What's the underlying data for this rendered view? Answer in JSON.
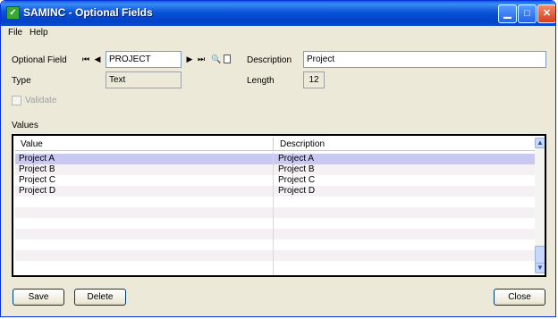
{
  "window": {
    "title": "SAMINC - Optional Fields",
    "controls": {
      "minimize": "▁",
      "maximize": "□",
      "close": "✕"
    }
  },
  "menu": {
    "file": "File",
    "help": "Help"
  },
  "form": {
    "optional_field_label": "Optional Field",
    "optional_field_value": "PROJECT",
    "description_label": "Description",
    "description_value": "Project",
    "type_label": "Type",
    "type_value": "Text",
    "length_label": "Length",
    "length_value": "12",
    "validate_label": "Validate",
    "validate_checked": false,
    "values_label": "Values"
  },
  "nav_icons": {
    "first": "first-record-icon",
    "prev": "previous-record-icon",
    "next": "next-record-icon",
    "last": "last-record-icon",
    "finder": "finder-icon",
    "new": "new-document-icon"
  },
  "grid": {
    "columns": [
      "Value",
      "Description"
    ],
    "rows": [
      {
        "value": "Project A",
        "description": "Project A"
      },
      {
        "value": "Project B",
        "description": "Project B"
      },
      {
        "value": "Project C",
        "description": "Project C"
      },
      {
        "value": "Project D",
        "description": "Project D"
      }
    ]
  },
  "buttons": {
    "save": "Save",
    "delete": "Delete",
    "close": "Close"
  },
  "colors": {
    "titlebar": "#0a53d8",
    "selected_row": "#c8c8f0",
    "face": "#ece9d8"
  }
}
